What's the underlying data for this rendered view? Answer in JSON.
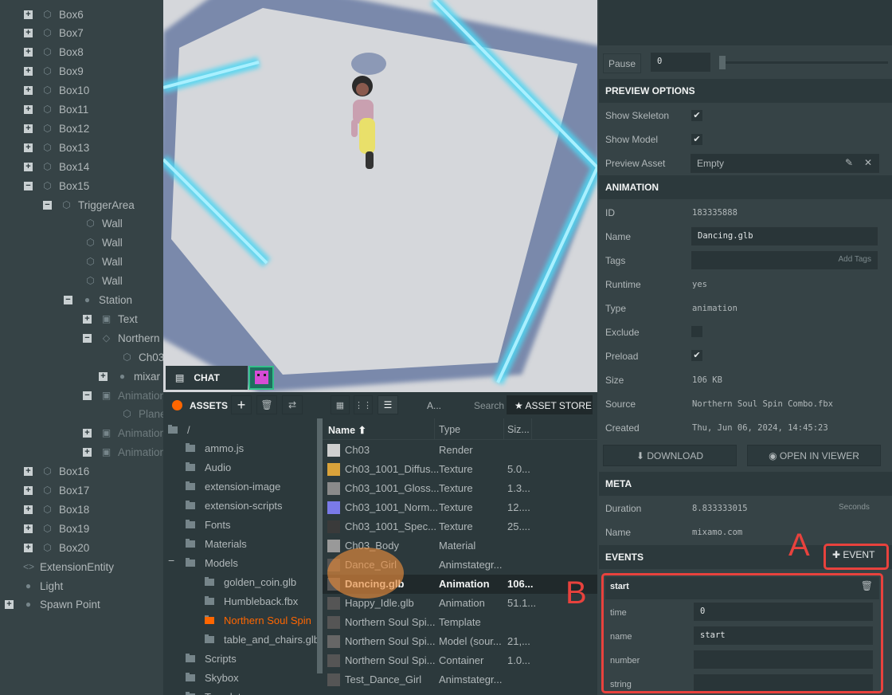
{
  "hierarchy": {
    "items": [
      {
        "label": "Box6",
        "tog": "+"
      },
      {
        "label": "Box7",
        "tog": "+"
      },
      {
        "label": "Box8",
        "tog": "+"
      },
      {
        "label": "Box9",
        "tog": "+"
      },
      {
        "label": "Box10",
        "tog": "+"
      },
      {
        "label": "Box11",
        "tog": "+"
      },
      {
        "label": "Box12",
        "tog": "+"
      },
      {
        "label": "Box13",
        "tog": "+"
      },
      {
        "label": "Box14",
        "tog": "+"
      },
      {
        "label": "Box15",
        "tog": "−"
      },
      {
        "label": "TriggerArea",
        "tog": "−"
      },
      {
        "label": "Wall"
      },
      {
        "label": "Wall"
      },
      {
        "label": "Wall"
      },
      {
        "label": "Wall"
      },
      {
        "label": "Station",
        "tog": "−"
      },
      {
        "label": "Text",
        "tog": "+"
      },
      {
        "label": "Northern",
        "tog": "−"
      },
      {
        "label": "Ch03"
      },
      {
        "label": "mixar",
        "tog": "+"
      },
      {
        "label": "Animation",
        "tog": "−"
      },
      {
        "label": "Plane"
      },
      {
        "label": "Animation",
        "tog": "+"
      },
      {
        "label": "Animation",
        "tog": "+"
      },
      {
        "label": "Box16",
        "tog": "+"
      },
      {
        "label": "Box17",
        "tog": "+"
      },
      {
        "label": "Box18",
        "tog": "+"
      },
      {
        "label": "Box19",
        "tog": "+"
      },
      {
        "label": "Box20",
        "tog": "+"
      },
      {
        "label": "ExtensionEntity"
      },
      {
        "label": "Light"
      },
      {
        "label": "Spawn Point",
        "tog": "+"
      }
    ]
  },
  "chat": {
    "label": "CHAT"
  },
  "assets": {
    "title": "ASSETS",
    "filter": "A...",
    "search_placeholder": "Search",
    "store": "ASSET STORE",
    "root": "/",
    "folders": [
      "ammo.js",
      "Audio",
      "extension-image",
      "extension-scripts",
      "Fonts",
      "Materials",
      "Models",
      "golden_coin.glb",
      "Humbleback.fbx",
      "Northern Soul Spin",
      "table_and_chairs.glb",
      "Scripts",
      "Skybox",
      "Templates"
    ],
    "columns": {
      "name": "Name",
      "type": "Type",
      "size": "Siz..."
    },
    "files": [
      {
        "name": "Ch03",
        "type": "Render",
        "size": ""
      },
      {
        "name": "Ch03_1001_Diffus...",
        "type": "Texture",
        "size": "5.0..."
      },
      {
        "name": "Ch03_1001_Gloss...",
        "type": "Texture",
        "size": "1.3..."
      },
      {
        "name": "Ch03_1001_Norm...",
        "type": "Texture",
        "size": "12...."
      },
      {
        "name": "Ch03_1001_Spec...",
        "type": "Texture",
        "size": "25...."
      },
      {
        "name": "Ch03_Body",
        "type": "Material",
        "size": ""
      },
      {
        "name": "Dance_Girl",
        "type": "Animstategr...",
        "size": ""
      },
      {
        "name": "Dancing.glb",
        "type": "Animation",
        "size": "106..."
      },
      {
        "name": "Happy_Idle.glb",
        "type": "Animation",
        "size": "51.1..."
      },
      {
        "name": "Northern Soul Spi...",
        "type": "Template",
        "size": ""
      },
      {
        "name": "Northern Soul Spi...",
        "type": "Model (sour...",
        "size": "21,..."
      },
      {
        "name": "Northern Soul Spi...",
        "type": "Container",
        "size": "1.0..."
      },
      {
        "name": "Test_Dance_Girl",
        "type": "Animstategr...",
        "size": ""
      }
    ]
  },
  "inspector": {
    "pause": "Pause",
    "time_value": "0",
    "preview_options": {
      "title": "PREVIEW OPTIONS",
      "show_skeleton": "Show Skeleton",
      "show_model": "Show Model",
      "preview_asset": "Preview Asset",
      "preview_asset_value": "Empty"
    },
    "animation": {
      "title": "ANIMATION",
      "id_label": "ID",
      "id": "183335888",
      "name_label": "Name",
      "name": "Dancing.glb",
      "tags_label": "Tags",
      "tags_placeholder": "Add Tags",
      "runtime_label": "Runtime",
      "runtime": "yes",
      "type_label": "Type",
      "type": "animation",
      "exclude_label": "Exclude",
      "preload_label": "Preload",
      "size_label": "Size",
      "size": "106 KB",
      "source_label": "Source",
      "source": "Northern Soul Spin Combo.fbx",
      "created_label": "Created",
      "created": "Thu, Jun 06, 2024, 14:45:23",
      "download": "DOWNLOAD",
      "open_viewer": "OPEN IN VIEWER"
    },
    "meta": {
      "title": "META",
      "duration_label": "Duration",
      "duration": "8.833333015",
      "duration_unit": "Seconds",
      "name_label": "Name",
      "name": "mixamo.com"
    },
    "events": {
      "title": "EVENTS",
      "add": "EVENT",
      "event_name": "start",
      "time_label": "time",
      "time": "0",
      "name_label": "name",
      "name": "start",
      "number_label": "number",
      "string_label": "string"
    }
  },
  "annotations": {
    "a": "A",
    "b": "B"
  },
  "colors": {
    "accent": "#f60",
    "highlight": "#e8423d",
    "panel": "#364346",
    "panel_dark": "#2c393c"
  }
}
